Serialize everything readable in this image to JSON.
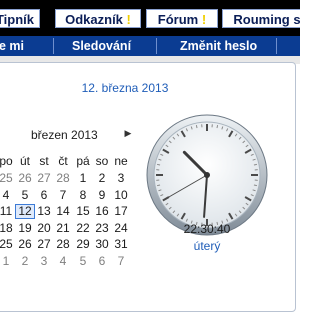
{
  "top_tabs": [
    {
      "label": "Tipník",
      "mark": ""
    },
    {
      "label": "Odkazník",
      "mark": "!"
    },
    {
      "label": "Fórum",
      "mark": "!"
    },
    {
      "label": "Rouming s",
      "mark": ""
    }
  ],
  "sub_nav": [
    "e mi",
    "Sledování",
    "Změnit heslo"
  ],
  "calendar": {
    "full_date": "12. března 2013",
    "month_label": "březen 2013",
    "next_icon": "right-triangle-icon",
    "day_names": [
      "po",
      "út",
      "st",
      "čt",
      "pá",
      "so",
      "ne"
    ],
    "weeks": [
      [
        "25",
        "26",
        "27",
        "28",
        "1",
        "2",
        "3"
      ],
      [
        "4",
        "5",
        "6",
        "7",
        "8",
        "9",
        "10"
      ],
      [
        "11",
        "12",
        "13",
        "14",
        "15",
        "16",
        "17"
      ],
      [
        "18",
        "19",
        "20",
        "21",
        "22",
        "23",
        "24"
      ],
      [
        "25",
        "26",
        "27",
        "28",
        "29",
        "30",
        "31"
      ],
      [
        "1",
        "2",
        "3",
        "4",
        "5",
        "6",
        "7"
      ]
    ],
    "selected_day": "12"
  },
  "clock": {
    "time": "22:30:40",
    "weekday": "úterý",
    "hours": 22,
    "minutes": 30,
    "seconds": 40
  }
}
